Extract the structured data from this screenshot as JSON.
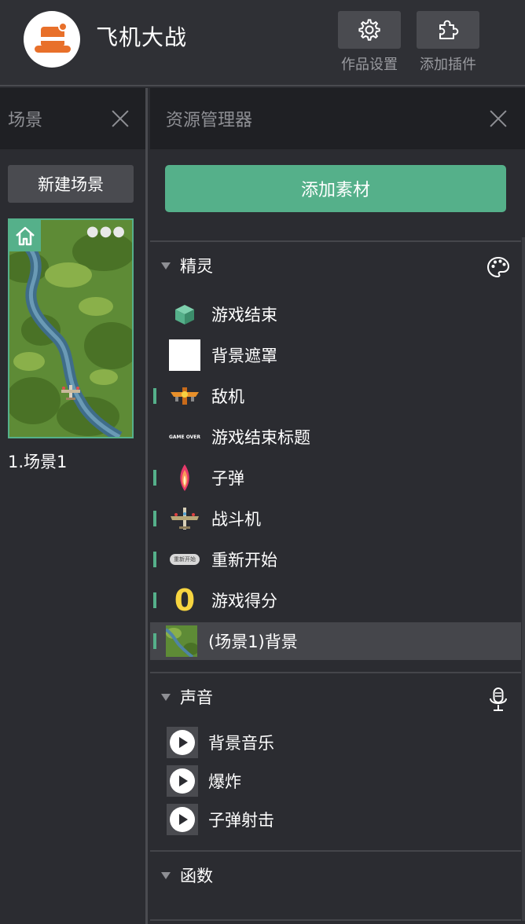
{
  "header": {
    "app_title": "飞机大战",
    "tools": [
      {
        "label": "作品设置",
        "icon": "gear-icon"
      },
      {
        "label": "添加插件",
        "icon": "puzzle-icon"
      }
    ]
  },
  "scene_panel": {
    "title": "场景",
    "new_scene_label": "新建场景",
    "scenes": [
      {
        "label": "1.场景1",
        "is_home": true
      }
    ]
  },
  "asset_panel": {
    "title": "资源管理器",
    "add_material_label": "添加素材",
    "sprites": {
      "title": "精灵",
      "items": [
        {
          "label": "游戏结束",
          "icon": "cube-icon",
          "marked": false
        },
        {
          "label": "背景遮罩",
          "icon": "white-square",
          "marked": false
        },
        {
          "label": "敌机",
          "icon": "enemy-plane",
          "marked": true
        },
        {
          "label": "游戏结束标题",
          "icon": "game-over-text",
          "icon_text": "GAME OVER",
          "marked": false
        },
        {
          "label": "子弹",
          "icon": "bullet-flame",
          "marked": true
        },
        {
          "label": "战斗机",
          "icon": "fighter-plane",
          "marked": true
        },
        {
          "label": "重新开始",
          "icon": "restart-pill",
          "icon_text": "重新开始",
          "marked": true
        },
        {
          "label": "游戏得分",
          "icon": "score-digit",
          "icon_text": "0",
          "marked": true
        },
        {
          "label": "(场景1)背景",
          "icon": "map-thumbnail",
          "marked": true,
          "selected": true
        }
      ]
    },
    "sounds": {
      "title": "声音",
      "items": [
        {
          "label": "背景音乐"
        },
        {
          "label": "爆炸"
        },
        {
          "label": "子弹射击"
        }
      ]
    },
    "functions": {
      "title": "函数"
    }
  },
  "colors": {
    "accent": "#55b08a",
    "background": "#2b2c31",
    "header": "#1f2024",
    "button": "#4a4b50",
    "logo_orange": "#e8702a",
    "score_yellow": "#f7d540"
  }
}
